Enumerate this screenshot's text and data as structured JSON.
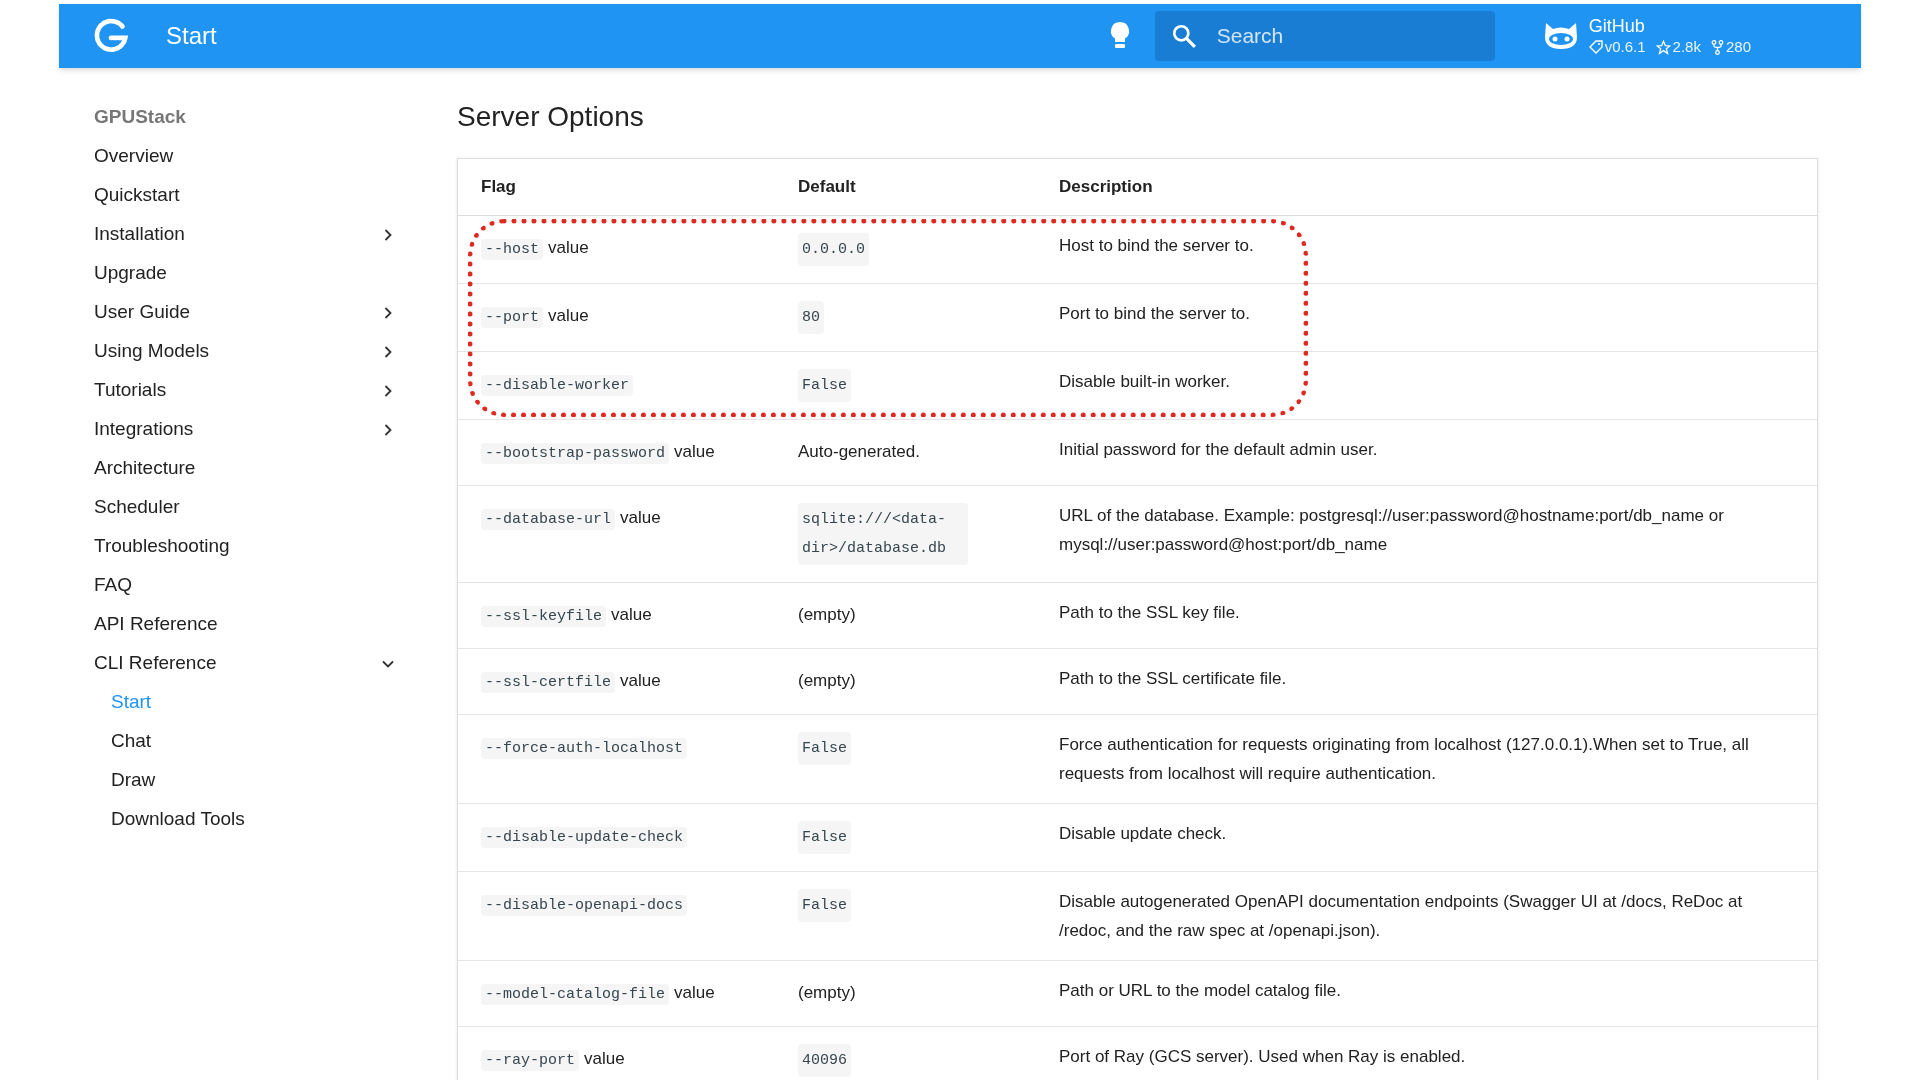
{
  "header": {
    "title": "Start",
    "search": {
      "placeholder": "Search"
    },
    "repo": {
      "name": "GitHub",
      "version": "v0.6.1",
      "stars": "2.8k",
      "forks": "280"
    }
  },
  "sidebar": {
    "title": "GPUStack",
    "items": [
      {
        "label": "Overview",
        "selected": false
      },
      {
        "label": "Quickstart",
        "selected": false
      },
      {
        "label": "Installation",
        "selected": false,
        "expanded": false
      },
      {
        "label": "Upgrade",
        "selected": false
      },
      {
        "label": "User Guide",
        "selected": false,
        "expanded": false
      },
      {
        "label": "Using Models",
        "selected": false,
        "expanded": false
      },
      {
        "label": "Tutorials",
        "selected": false,
        "expanded": false
      },
      {
        "label": "Integrations",
        "selected": false,
        "expanded": false
      },
      {
        "label": "Architecture",
        "selected": false
      },
      {
        "label": "Scheduler",
        "selected": false
      },
      {
        "label": "Troubleshooting",
        "selected": false
      },
      {
        "label": "FAQ",
        "selected": false
      },
      {
        "label": "API Reference",
        "selected": false
      },
      {
        "label": "CLI Reference",
        "selected": false,
        "expanded": true,
        "children": [
          {
            "label": "Start",
            "selected": true
          },
          {
            "label": "Chat",
            "selected": false
          },
          {
            "label": "Draw",
            "selected": false
          },
          {
            "label": "Download Tools",
            "selected": false
          }
        ]
      }
    ]
  },
  "content": {
    "title": "Server Options",
    "table": {
      "columns": [
        "Flag",
        "Default",
        "Description"
      ],
      "rows": [
        {
          "flag": "--host",
          "flag_suffix": "value",
          "default_code": "0.0.0.0",
          "description": "Host to bind the server to.",
          "highlighted": true
        },
        {
          "flag": "--port",
          "flag_suffix": "value",
          "default_code": "80",
          "description": "Port to bind the server to.",
          "highlighted": true
        },
        {
          "flag": "--disable-worker",
          "default_code": "False",
          "description": "Disable built-in worker.",
          "highlighted": true
        },
        {
          "flag": "--bootstrap-password",
          "flag_suffix": "value",
          "default": "Auto-generated.",
          "description": "Initial password for the default admin user.",
          "highlighted": false
        },
        {
          "flag": "--database-url",
          "flag_suffix": "value",
          "default_code": "sqlite:///<data-dir>/database.db",
          "description": "URL of the database. Example: postgresql://user:password@hostname:port/db_name or mysql://user:password@host:port/db_name",
          "highlighted": false
        },
        {
          "flag": "--ssl-keyfile",
          "flag_suffix": "value",
          "default": "(empty)",
          "description": "Path to the SSL key file.",
          "highlighted": false
        },
        {
          "flag": "--ssl-certfile",
          "flag_suffix": "value",
          "default": "(empty)",
          "description": "Path to the SSL certificate file.",
          "highlighted": false
        },
        {
          "flag": "--force-auth-localhost",
          "default_code": "False",
          "description": "Force authentication for requests originating from localhost (127.0.0.1).When set to True, all requests from localhost will require authentication.",
          "highlighted": false
        },
        {
          "flag": "--disable-update-check",
          "default_code": "False",
          "description": "Disable update check.",
          "highlighted": false
        },
        {
          "flag": "--disable-openapi-docs",
          "default_code": "False",
          "description": "Disable autogenerated OpenAPI documentation endpoints (Swagger UI at /docs, ReDoc at /redoc, and the raw spec at /openapi.json).",
          "highlighted": false
        },
        {
          "flag": "--model-catalog-file",
          "flag_suffix": "value",
          "default": "(empty)",
          "description": "Path or URL to the model catalog file.",
          "highlighted": false
        },
        {
          "flag": "--ray-port",
          "flag_suffix": "value",
          "default_code": "40096",
          "description": "Port of Ray (GCS server). Used when Ray is enabled.",
          "highlighted": false
        }
      ]
    }
  }
}
